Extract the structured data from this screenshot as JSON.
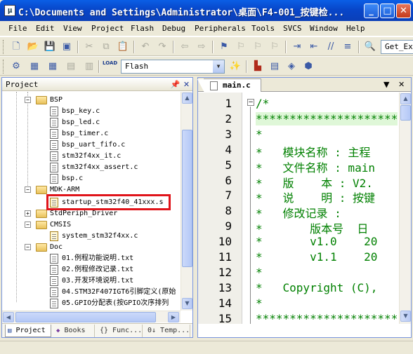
{
  "window": {
    "title": "C:\\Documents and Settings\\Administrator\\桌面\\F4-001_按键检...",
    "minimize_glyph": "_",
    "maximize_glyph": "□",
    "close_glyph": "✕"
  },
  "menu": [
    "File",
    "Edit",
    "View",
    "Project",
    "Flash",
    "Debug",
    "Peripherals",
    "Tools",
    "SVCS",
    "Window",
    "Help"
  ],
  "toolbar1": {
    "find_combo_value": "Get_Ex"
  },
  "toolbar2": {
    "target_combo_value": "Flash",
    "load_label": "LOAD"
  },
  "project_panel": {
    "title": "Project",
    "tree": [
      {
        "type": "folder",
        "label": "BSP",
        "expanded": true
      },
      {
        "type": "file",
        "label": "bsp_key.c"
      },
      {
        "type": "file",
        "label": "bsp_led.c"
      },
      {
        "type": "file",
        "label": "bsp_timer.c"
      },
      {
        "type": "file",
        "label": "bsp_uart_fifo.c"
      },
      {
        "type": "file",
        "label": "stm32f4xx_it.c"
      },
      {
        "type": "file",
        "label": "stm32f4xx_assert.c"
      },
      {
        "type": "file",
        "label": "bsp.c"
      },
      {
        "type": "folder",
        "label": "MDK-ARM",
        "expanded": true
      },
      {
        "type": "asm-file",
        "label": "startup_stm32f40_41xxx.s",
        "highlighted": true
      },
      {
        "type": "folder",
        "label": "StdPeriph_Driver",
        "expanded": false
      },
      {
        "type": "folder",
        "label": "CMSIS",
        "expanded": true
      },
      {
        "type": "asm-file",
        "label": "system_stm32f4xx.c"
      },
      {
        "type": "folder",
        "label": "Doc",
        "expanded": true
      },
      {
        "type": "file",
        "label": "01.例程功能说明.txt"
      },
      {
        "type": "file",
        "label": "02.例程修改记录.txt"
      },
      {
        "type": "file",
        "label": "03.开发环境说明.txt"
      },
      {
        "type": "file",
        "label": "04.STM32F407IGT6引脚定义(原始"
      },
      {
        "type": "file",
        "label": "05.GPIO分配表(按GPIO次序排列"
      }
    ],
    "tabs": [
      "Project",
      "Books",
      "{} Func...",
      "0↓ Temp..."
    ]
  },
  "editor": {
    "tab_label": "main.c",
    "lines": [
      {
        "n": "1",
        "text": "/*"
      },
      {
        "n": "2",
        "text": "*********************"
      },
      {
        "n": "3",
        "text": "*"
      },
      {
        "n": "4",
        "text": "*   模块名称 : 主程"
      },
      {
        "n": "5",
        "text": "*   文件名称 : main"
      },
      {
        "n": "6",
        "text": "*   版    本 : V2."
      },
      {
        "n": "7",
        "text": "*   说    明 : 按键"
      },
      {
        "n": "8",
        "text": "*   修改记录 :"
      },
      {
        "n": "9",
        "text": "*       版本号  日"
      },
      {
        "n": "10",
        "text": "*       v1.0    20"
      },
      {
        "n": "11",
        "text": "*       v1.1    20"
      },
      {
        "n": "12",
        "text": "*"
      },
      {
        "n": "13",
        "text": "*   Copyright (C),"
      },
      {
        "n": "14",
        "text": "*"
      },
      {
        "n": "15",
        "text": "*********************"
      }
    ]
  },
  "colors": {
    "highlight_box": "#e0141a",
    "comment": "#008000",
    "titlebar": "#0a5fe6"
  }
}
